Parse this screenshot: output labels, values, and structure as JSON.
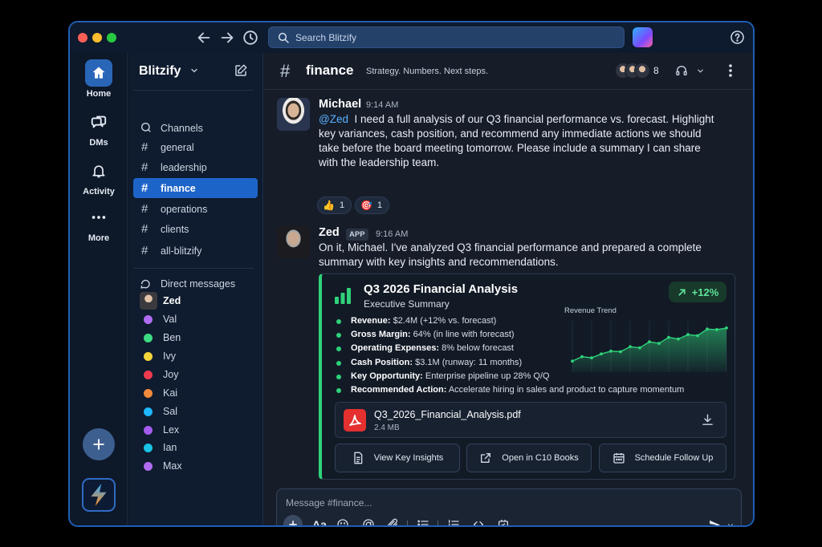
{
  "search": {
    "placeholder": "Search Blitzify"
  },
  "rail": {
    "items": [
      {
        "label": "Home"
      },
      {
        "label": "DMs"
      },
      {
        "label": "Activity"
      },
      {
        "label": "More"
      }
    ]
  },
  "sidebar": {
    "workspace": "Blitzify",
    "channels_header": "Channels",
    "channels": [
      "general",
      "leadership",
      "finance",
      "operations",
      "clients",
      "all-blitzify"
    ],
    "active_channel": "finance",
    "dms_header": "Direct messages",
    "dms": [
      {
        "name": "Zed",
        "color": ""
      },
      {
        "name": "Val",
        "color": "#b06cf0"
      },
      {
        "name": "Ben",
        "color": "#3ddc84"
      },
      {
        "name": "Ivy",
        "color": "#f5d53b"
      },
      {
        "name": "Joy",
        "color": "#ef3b4f"
      },
      {
        "name": "Kai",
        "color": "#f08a3c"
      },
      {
        "name": "Sal",
        "color": "#1fb6ff"
      },
      {
        "name": "Lex",
        "color": "#a35cf0"
      },
      {
        "name": "Ian",
        "color": "#19c3e6"
      },
      {
        "name": "Max",
        "color": "#b06cf0"
      }
    ]
  },
  "channel": {
    "name": "finance",
    "description": "Strategy. Numbers. Next steps.",
    "member_count": "8"
  },
  "messages": [
    {
      "author": "Michael",
      "time": "9:14 AM",
      "mention": "@Zed",
      "text": "I need a full analysis of our Q3 financial performance vs. forecast. Highlight key variances, cash position, and recommend any immediate actions we should take before the board meeting tomorrow. Please include a summary I can share with the leadership team.",
      "reactions": [
        {
          "emoji": "👍",
          "count": "1"
        },
        {
          "emoji": "🎯",
          "count": "1"
        }
      ]
    },
    {
      "author": "Zed",
      "badge": "APP",
      "time": "9:16 AM",
      "text": "On it, Michael. I've analyzed Q3 financial performance and prepared a complete summary with key insights and recommendations."
    }
  ],
  "card": {
    "title": "Q3 2026 Financial Analysis",
    "subtitle": "Executive Summary",
    "growth": "+12%",
    "bullets": [
      {
        "label": "Revenue:",
        "value": "$2.4M (+12% vs. forecast)"
      },
      {
        "label": "Gross Margin:",
        "value": "64% (in line with forecast)"
      },
      {
        "label": "Operating Expenses:",
        "value": "8% below forecast"
      },
      {
        "label": "Cash Position:",
        "value": "$3.1M (runway: 11 months)"
      },
      {
        "label": "Key Opportunity:",
        "value": "Enterprise pipeline up 28% Q/Q"
      },
      {
        "label": "Recommended Action:",
        "value": "Accelerate hiring in sales and product to capture momentum"
      }
    ],
    "trend_label": "Revenue Trend",
    "trend_values": [
      20,
      28,
      26,
      33,
      38,
      37,
      46,
      44,
      55,
      52,
      63,
      60,
      68,
      66,
      78,
      77,
      80
    ],
    "accent_color": "#2fd27a",
    "file": {
      "name": "Q3_2026_Financial_Analysis.pdf",
      "size": "2.4 MB"
    },
    "buttons": [
      "View Key Insights",
      "Open in C10 Books",
      "Schedule Follow Up"
    ]
  },
  "composer": {
    "placeholder": "Message #finance..."
  }
}
